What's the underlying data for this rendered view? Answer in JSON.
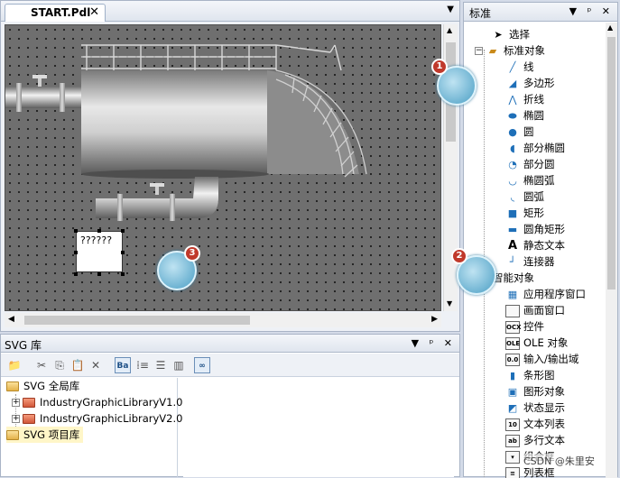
{
  "editor": {
    "tab_label": "START.Pdl",
    "tab_close": "✕",
    "menu_arrow": "▼",
    "text_field_value": "??????"
  },
  "badges": {
    "one": "1",
    "two": "2",
    "three": "3"
  },
  "toolbox": {
    "title": "标准",
    "controls": "▼ ᵖ ✕",
    "items": [
      {
        "label": "选择",
        "icon": "arrow-pointer-icon"
      },
      {
        "label": "标准对象",
        "icon": "standard-objects-folder-icon"
      },
      {
        "label": "线",
        "icon": "line-icon"
      },
      {
        "label": "多边形",
        "icon": "polygon-icon"
      },
      {
        "label": "折线",
        "icon": "polyline-icon"
      },
      {
        "label": "椭圆",
        "icon": "ellipse-icon"
      },
      {
        "label": "圆",
        "icon": "circle-icon"
      },
      {
        "label": "部分椭圆",
        "icon": "ellipse-segment-icon"
      },
      {
        "label": "部分圆",
        "icon": "circle-segment-icon"
      },
      {
        "label": "椭圆弧",
        "icon": "ellipse-arc-icon"
      },
      {
        "label": "圆弧",
        "icon": "circle-arc-icon"
      },
      {
        "label": "矩形",
        "icon": "rectangle-icon"
      },
      {
        "label": "圆角矩形",
        "icon": "rounded-rectangle-icon"
      },
      {
        "label": "静态文本",
        "icon": "static-text-icon"
      },
      {
        "label": "连接器",
        "icon": "connector-icon"
      },
      {
        "label": "智能对象",
        "icon": "smart-objects-folder-icon"
      },
      {
        "label": "应用程序窗口",
        "icon": "application-window-icon"
      },
      {
        "label": "画面窗口",
        "icon": "picture-window-icon"
      },
      {
        "label": "控件",
        "icon": "control-icon"
      },
      {
        "label": "OLE 对象",
        "icon": "ole-object-icon"
      },
      {
        "label": "输入/输出域",
        "icon": "io-field-icon"
      },
      {
        "label": "条形图",
        "icon": "bar-icon"
      },
      {
        "label": "图形对象",
        "icon": "graphic-object-icon"
      },
      {
        "label": "状态显示",
        "icon": "status-display-icon"
      },
      {
        "label": "文本列表",
        "icon": "text-list-icon"
      },
      {
        "label": "多行文本",
        "icon": "multiline-text-icon"
      },
      {
        "label": "组合框",
        "icon": "combobox-icon"
      },
      {
        "label": "列表框",
        "icon": "listbox-icon"
      }
    ]
  },
  "svg_library": {
    "title": "SVG 库",
    "controls": "▼ ᵖ ✕",
    "tree": [
      {
        "label": "SVG 全局库"
      },
      {
        "label": "IndustryGraphicLibraryV1.0"
      },
      {
        "label": "IndustryGraphicLibraryV2.0"
      },
      {
        "label": "SVG 项目库"
      }
    ]
  },
  "watermark": "CSDN @朱里安"
}
